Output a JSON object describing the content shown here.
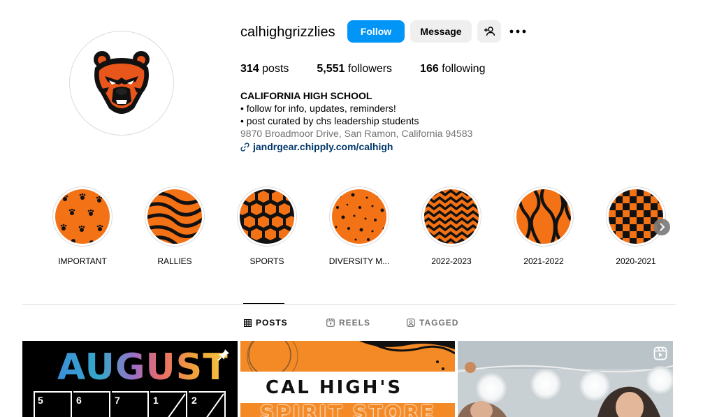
{
  "profile": {
    "username": "calhighgrizzlies",
    "follow_label": "Follow",
    "message_label": "Message",
    "posts_count": "314",
    "posts_label": "posts",
    "followers_count": "5,551",
    "followers_label": "followers",
    "following_count": "166",
    "following_label": "following",
    "display_name": "CALIFORNIA HIGH SCHOOL",
    "bio_line1": "• follow for info, updates, reminders!",
    "bio_line2": "• post curated by chs leadership students",
    "address": "9870 Broadmoor Drive, San Ramon, California 94583",
    "link": "jandrgear.chipply.com/calhigh"
  },
  "highlights": [
    {
      "label": "IMPORTANT",
      "pattern": "paw-prints"
    },
    {
      "label": "RALLIES",
      "pattern": "stripes"
    },
    {
      "label": "SPORTS",
      "pattern": "hexagons"
    },
    {
      "label": "DIVERSITY M...",
      "pattern": "dots"
    },
    {
      "label": "2022-2023",
      "pattern": "chevrons"
    },
    {
      "label": "2021-2022",
      "pattern": "tiger"
    },
    {
      "label": "2020-2021",
      "pattern": "checkers"
    }
  ],
  "tabs": [
    {
      "label": "POSTS",
      "icon": "grid-icon",
      "active": true
    },
    {
      "label": "REELS",
      "icon": "reels-icon",
      "active": false
    },
    {
      "label": "TAGGED",
      "icon": "tagged-icon",
      "active": false
    }
  ],
  "posts": {
    "post1_title": "AUGUST",
    "post1_days": [
      "5",
      "6",
      "7",
      "1",
      "2"
    ],
    "post2_title": "CAL HIGH'S",
    "post2_subtitle": "SPIRIT STORE"
  },
  "colors": {
    "follow_blue": "#0095f6",
    "link_blue": "#00376b",
    "brand_orange": "#f47216"
  }
}
